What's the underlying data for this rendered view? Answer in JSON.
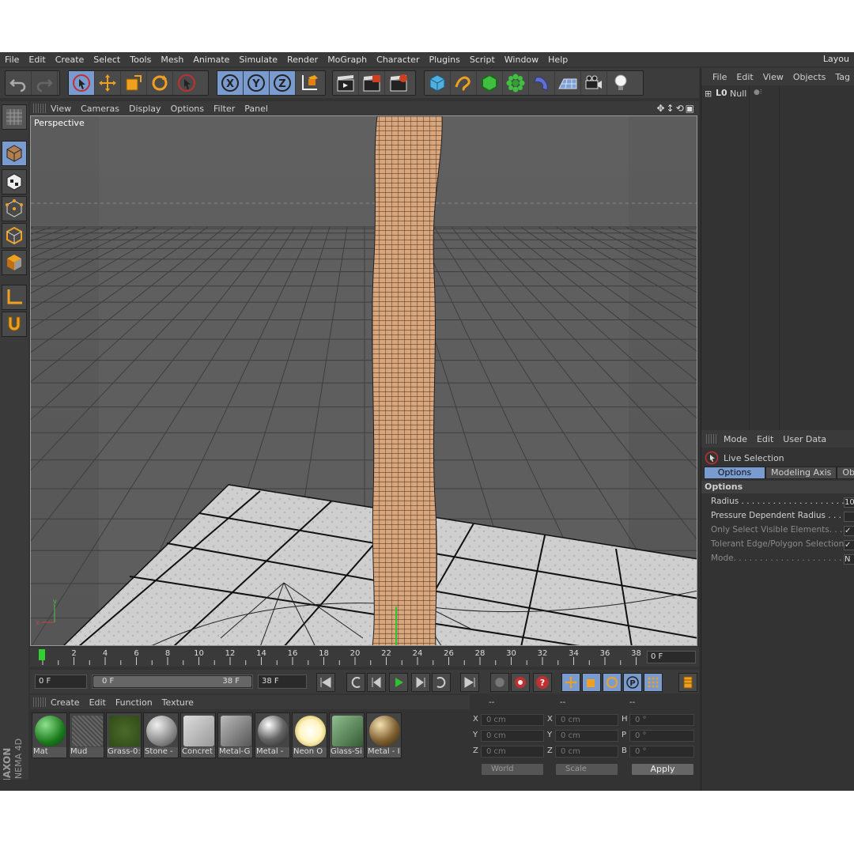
{
  "menu": [
    "File",
    "Edit",
    "Create",
    "Select",
    "Tools",
    "Mesh",
    "Animate",
    "Simulate",
    "Render",
    "MoGraph",
    "Character",
    "Plugins",
    "Script",
    "Window",
    "Help"
  ],
  "layout_label": "Layou",
  "viewport": {
    "menu": [
      "View",
      "Cameras",
      "Display",
      "Options",
      "Filter",
      "Panel"
    ],
    "label": "Perspective"
  },
  "toolbar": {
    "axis_x": "X",
    "axis_y": "Y",
    "axis_z": "Z"
  },
  "timeline": {
    "ticks": [
      "0",
      "2",
      "4",
      "6",
      "8",
      "10",
      "12",
      "14",
      "16",
      "18",
      "20",
      "22",
      "24",
      "26",
      "28",
      "30",
      "32",
      "34",
      "36",
      "38"
    ],
    "current_frame": "0 F"
  },
  "transport": {
    "start": "0 F",
    "range_start": "0 F",
    "range_end": "38 F",
    "end": "38 F"
  },
  "materials": {
    "menu": [
      "Create",
      "Edit",
      "Function",
      "Texture"
    ],
    "items": [
      {
        "label": "Mat",
        "type": "green"
      },
      {
        "label": "Mud",
        "type": "mud"
      },
      {
        "label": "Grass-0:",
        "type": "grass"
      },
      {
        "label": "Stone -",
        "type": "stone"
      },
      {
        "label": "Concret",
        "type": "concrete"
      },
      {
        "label": "Metal-G",
        "type": "metalg"
      },
      {
        "label": "Metal -",
        "type": "metal"
      },
      {
        "label": "Neon O",
        "type": "neon"
      },
      {
        "label": "Glass-Si",
        "type": "glass"
      },
      {
        "label": "Metal - I",
        "type": "bronze"
      }
    ]
  },
  "brand": {
    "line1": "MAXON",
    "line2": "CINEMA 4D"
  },
  "coords": {
    "headers": [
      "--",
      "--",
      "--"
    ],
    "rows": [
      {
        "l1": "X",
        "v1": "0 cm",
        "l2": "X",
        "v2": "0 cm",
        "l3": "H",
        "v3": "0 °"
      },
      {
        "l1": "Y",
        "v1": "0 cm",
        "l2": "Y",
        "v2": "0 cm",
        "l3": "P",
        "v3": "0 °"
      },
      {
        "l1": "Z",
        "v1": "0 cm",
        "l2": "Z",
        "v2": "0 cm",
        "l3": "B",
        "v3": "0 °"
      }
    ],
    "space": "World",
    "mode": "Scale",
    "apply": "Apply"
  },
  "objects": {
    "menu": [
      "File",
      "Edit",
      "View",
      "Objects",
      "Tag"
    ],
    "items": [
      {
        "name": "Null"
      }
    ]
  },
  "attributes": {
    "menu": [
      "Mode",
      "Edit",
      "User Data"
    ],
    "title": "Live Selection",
    "tabs": [
      "Options",
      "Modeling Axis",
      "Obje"
    ],
    "section": "Options",
    "rows": [
      {
        "label": "Radius . . . . . . . . . . . . . . . . . . . . .",
        "value": "10",
        "dim": false
      },
      {
        "label": "Pressure Dependent Radius . . . .",
        "value": "",
        "dim": false
      },
      {
        "label": "Only Select Visible Elements. . . .",
        "value": "✓",
        "dim": true
      },
      {
        "label": "Tolerant Edge/Polygon Selection",
        "value": "✓",
        "dim": true
      },
      {
        "label": "Mode. . . . . . . . . . . . . . . . . . . . . . .",
        "value": "N",
        "dim": true
      }
    ]
  },
  "colors": {
    "accent": "#7a9bd0",
    "orange": "#f0a020",
    "bg": "#333333"
  }
}
